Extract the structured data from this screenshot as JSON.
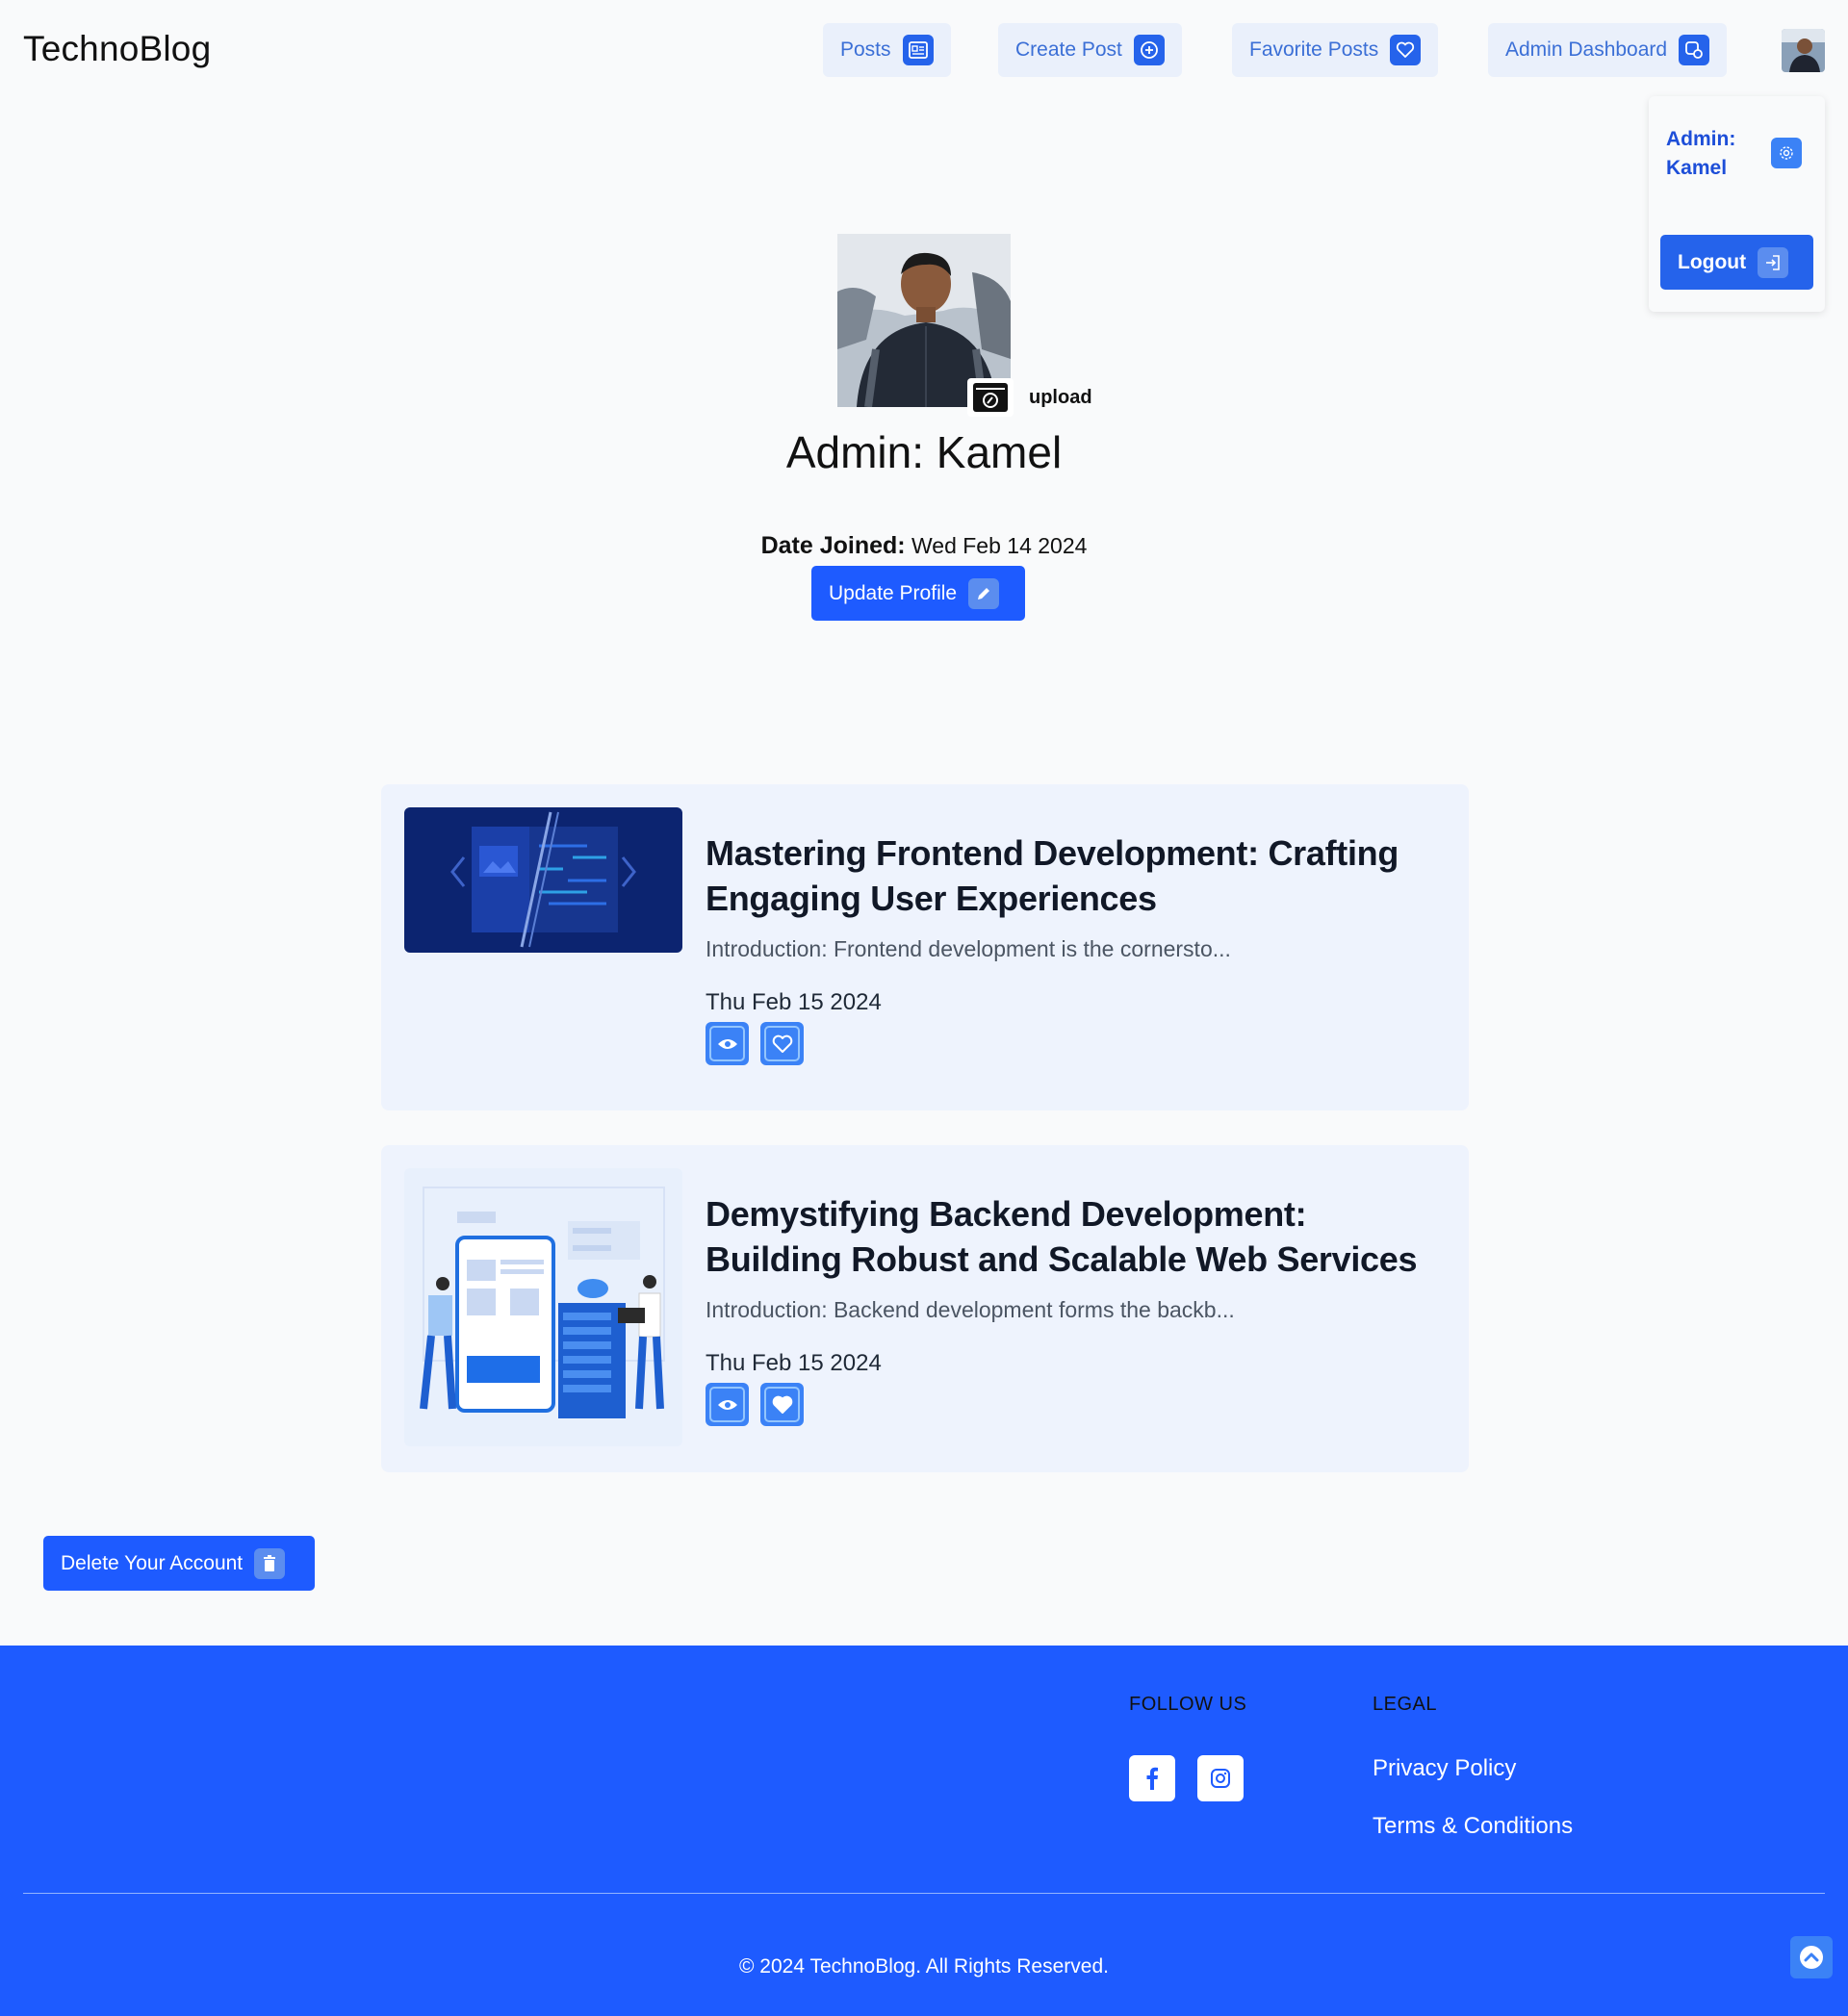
{
  "header": {
    "brand": "TechnoBlog",
    "nav": [
      {
        "label": "Posts",
        "icon": "newspaper-icon"
      },
      {
        "label": "Create Post",
        "icon": "plus-circle-icon"
      },
      {
        "label": "Favorite Posts",
        "icon": "heart-icon"
      },
      {
        "label": "Admin Dashboard",
        "icon": "dashboard-icon"
      }
    ]
  },
  "dropdown": {
    "name_line1": "Admin:",
    "name_line2": "Kamel",
    "logout_label": "Logout"
  },
  "profile": {
    "upload_label": "upload",
    "name": "Admin: Kamel",
    "date_joined_label": "Date Joined:",
    "date_joined_value": "Wed Feb 14 2024",
    "update_label": "Update Profile"
  },
  "posts": [
    {
      "title": "Mastering Frontend Development: Crafting Engaging User Experiences",
      "excerpt": "Introduction: Frontend development is the cornersto...",
      "date": "Thu Feb 15 2024",
      "favorited": false
    },
    {
      "title": "Demystifying Backend Development: Building Robust and Scalable Web Services",
      "excerpt": "Introduction: Backend development forms the backb...",
      "date": "Thu Feb 15 2024",
      "favorited": true
    }
  ],
  "delete_label": "Delete Your Account",
  "footer": {
    "follow_us": "FOLLOW US",
    "legal": "LEGAL",
    "privacy": "Privacy Policy",
    "terms": "Terms & Conditions",
    "copyright": "© 2024 TechnoBlog. All Rights Reserved."
  },
  "colors": {
    "primary": "#1e5bff",
    "nav_bg": "#eaf0fb",
    "card_bg": "#eef3fd"
  }
}
